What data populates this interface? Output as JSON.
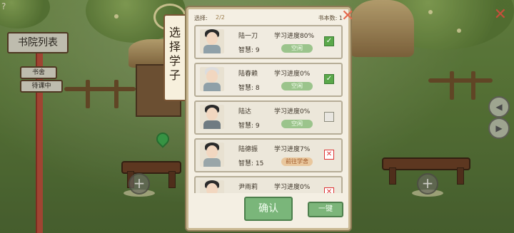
{
  "hud": {
    "help_icon_text": "?",
    "close_icon_text": "✕"
  },
  "sign": {
    "title": "书院列表",
    "items": [
      "书舍",
      "待课中"
    ]
  },
  "panel": {
    "title": "选择学子",
    "selected_label": "选择:",
    "selected_count": "2/2",
    "books_label": "书本数: 1",
    "confirm_label": "确认",
    "onekey_label": "一键",
    "close_icon_text": "✕"
  },
  "students": [
    {
      "name": "陆一刀",
      "progress": "学习进度80%",
      "wisdom": "智慧: 9",
      "status": "空闲",
      "status_type": "free",
      "check": "✓",
      "check_state": "on"
    },
    {
      "name": "陆春赖",
      "progress": "学习进度0%",
      "wisdom": "智慧: 8",
      "status": "空闲",
      "status_type": "free",
      "check": "✓",
      "check_state": "on"
    },
    {
      "name": "陆达",
      "progress": "学习进度0%",
      "wisdom": "智慧: 9",
      "status": "空闲",
      "status_type": "free",
      "check": "",
      "check_state": "off"
    },
    {
      "name": "陆德振",
      "progress": "学习进度7%",
      "wisdom": "智慧: 15",
      "status": "前往学舍",
      "status_type": "busy",
      "check": "✕",
      "check_state": "blocked"
    },
    {
      "name": "尹雨莉",
      "progress": "学习进度0%",
      "wisdom": "",
      "status": "",
      "status_type": "",
      "check": "✕",
      "check_state": "blocked"
    }
  ],
  "side_buttons": [
    "◀",
    "▶"
  ],
  "colors": {
    "accent_green": "#7ab67a",
    "close_red": "#e36a4e"
  }
}
